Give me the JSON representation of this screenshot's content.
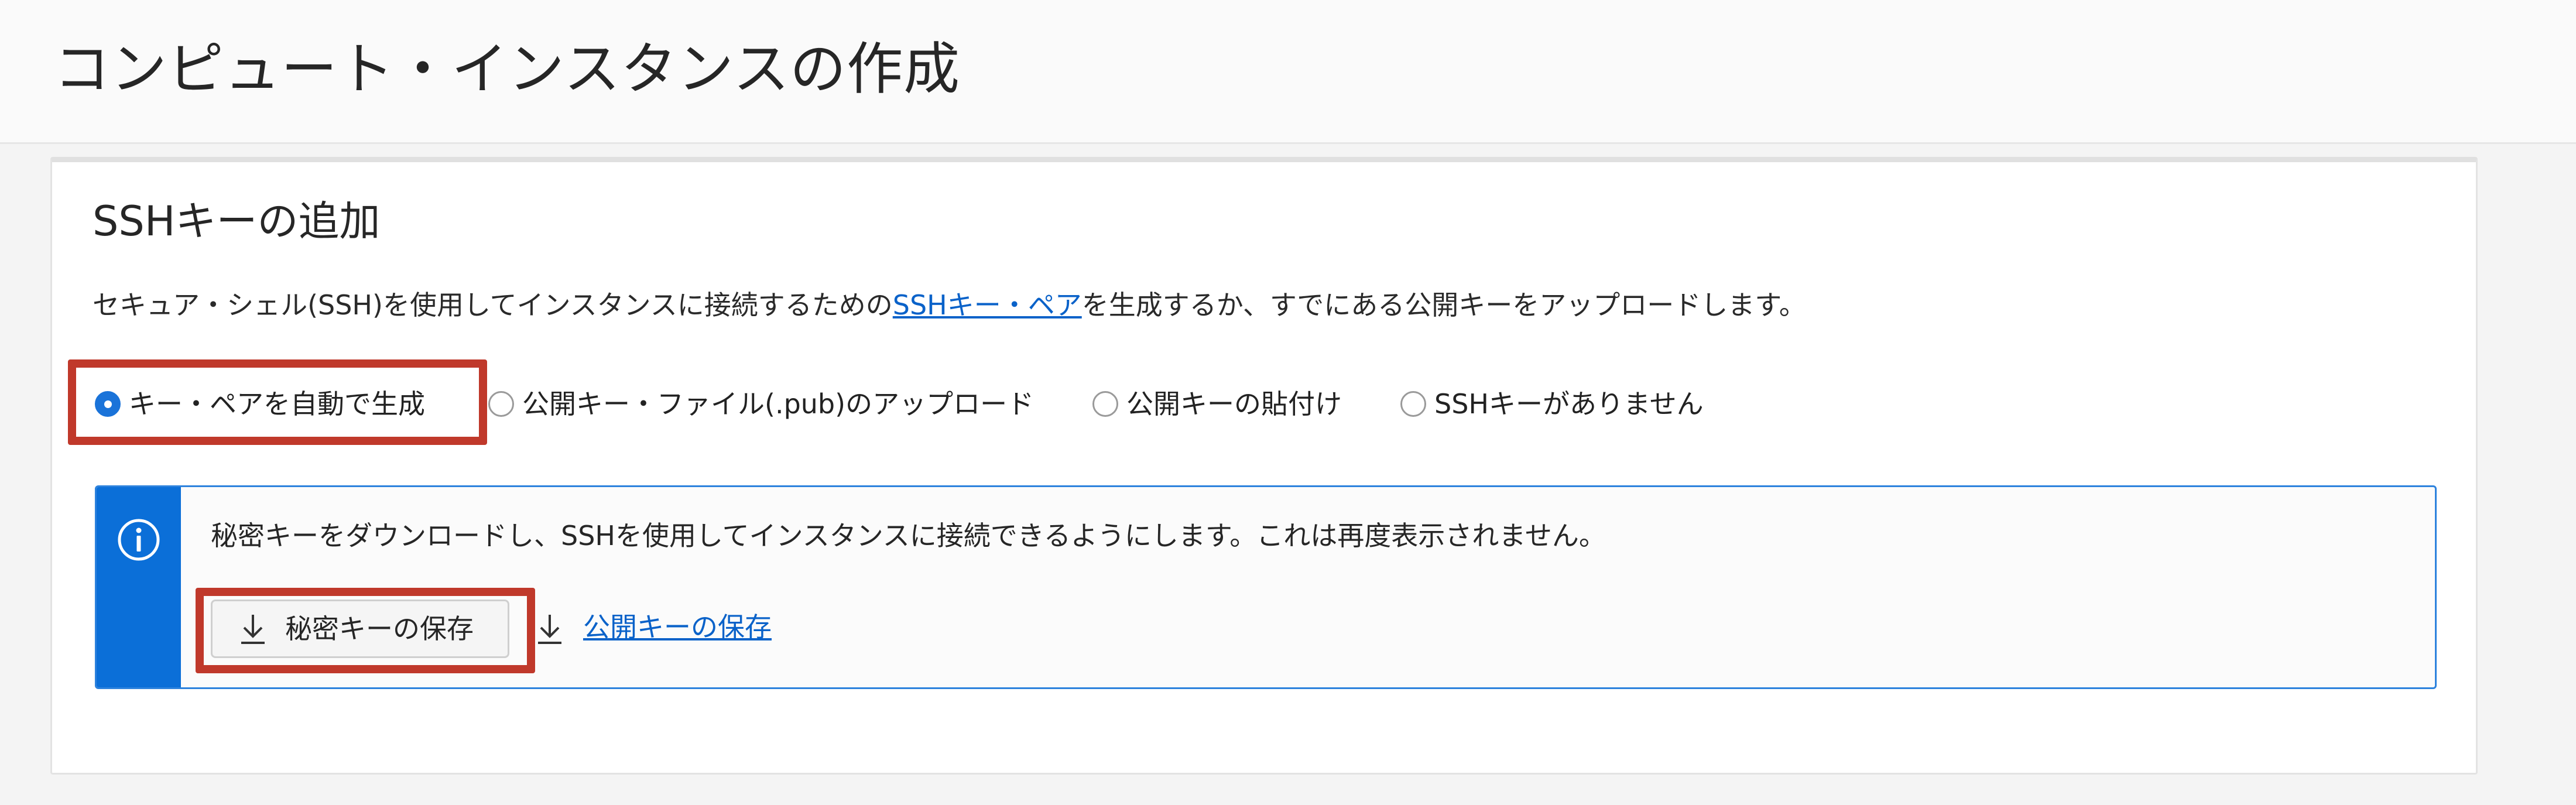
{
  "page": {
    "title": "コンピュート・インスタンスの作成"
  },
  "ssh_section": {
    "title": "SSHキーの追加",
    "description_before": "セキュア・シェル(SSH)を使用してインスタンスに接続するための",
    "description_link": "SSHキー・ペア",
    "description_after": "を生成するか、すでにある公開キーをアップロードします。",
    "options": [
      {
        "label": "キー・ペアを自動で生成",
        "selected": true
      },
      {
        "label": "公開キー・ファイル(.pub)のアップロード",
        "selected": false
      },
      {
        "label": "公開キーの貼付け",
        "selected": false
      },
      {
        "label": "SSHキーがありません",
        "selected": false
      }
    ]
  },
  "info_box": {
    "icon": "info-icon",
    "message": "秘密キーをダウンロードし、SSHを使用してインスタンスに接続できるようにします。これは再度表示されません。",
    "save_private_key_label": "秘密キーの保存",
    "save_public_key_label": "公開キーの保存",
    "download_icon": "download-icon"
  },
  "colors": {
    "accent": "#0b6fd8",
    "link": "#0a62c9",
    "highlight": "#c0392b"
  }
}
